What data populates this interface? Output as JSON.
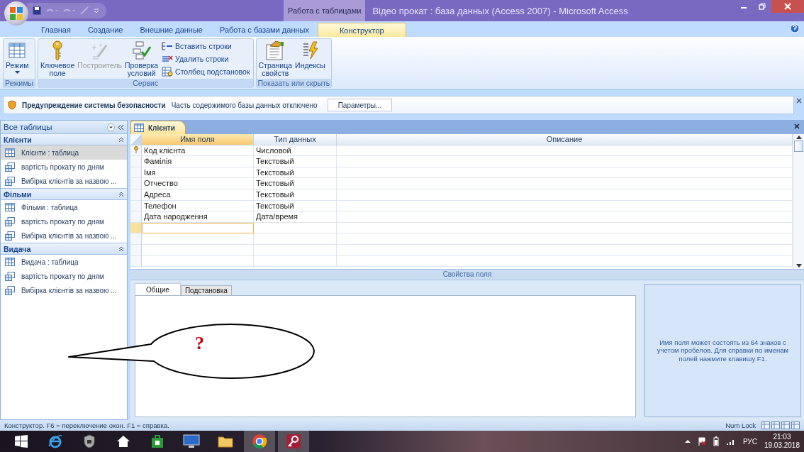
{
  "window": {
    "title": "Відео прокат : база данных (Access 2007) - Microsoft Access",
    "context_tab": "Работа с таблицами"
  },
  "ribbon": {
    "tabs": [
      {
        "label": "Главная",
        "selected": false
      },
      {
        "label": "Создание",
        "selected": false
      },
      {
        "label": "Внешние данные",
        "selected": false
      },
      {
        "label": "Работа с базами данных",
        "selected": false
      },
      {
        "label": "Конструктор",
        "selected": true
      }
    ],
    "groups": [
      {
        "label": "Режимы",
        "buttons": [
          {
            "label": "Режим",
            "kind": "view",
            "disabled": false
          }
        ]
      },
      {
        "label": "Сервис",
        "buttons": [
          {
            "label": "Ключевое поле",
            "kind": "key",
            "disabled": false
          },
          {
            "label": "Построитель",
            "kind": "builder",
            "disabled": true
          },
          {
            "label": "Проверка условий",
            "kind": "check",
            "disabled": false
          },
          {
            "label": "Вставить строки",
            "kind": "insert",
            "disabled": false
          },
          {
            "label": "Удалить строки",
            "kind": "delete",
            "disabled": false
          },
          {
            "label": "Столбец подстановок",
            "kind": "lookup",
            "disabled": false
          }
        ]
      },
      {
        "label": "Показать или скрыть",
        "buttons": [
          {
            "label": "Страница свойств",
            "kind": "sheet",
            "disabled": false
          },
          {
            "label": "Индексы",
            "kind": "indexes",
            "disabled": false
          }
        ]
      }
    ]
  },
  "security_bar": {
    "title": "Предупреждение системы безопасности",
    "message": "Часть содержимого базы данных отключено",
    "button": "Параметры..."
  },
  "nav_pane": {
    "title": "Все таблицы",
    "groups": [
      {
        "label": "Клієнти",
        "expanded": true,
        "items": [
          {
            "label": "Клієнти : таблица",
            "kind": "table",
            "selected": true
          },
          {
            "label": "вартість прокату по дням",
            "kind": "query",
            "selected": false
          },
          {
            "label": "Вибірка клієнтів за назвою ...",
            "kind": "query",
            "selected": false
          }
        ]
      },
      {
        "label": "Фільми",
        "expanded": true,
        "items": [
          {
            "label": "Фільми : таблица",
            "kind": "table",
            "selected": false
          },
          {
            "label": "вартість прокату по дням",
            "kind": "query",
            "selected": false
          },
          {
            "label": "Вибірка клієнтів за назвою ...",
            "kind": "query",
            "selected": false
          }
        ]
      },
      {
        "label": "Видача",
        "expanded": true,
        "items": [
          {
            "label": "Видача : таблица",
            "kind": "table",
            "selected": false
          },
          {
            "label": "вартість прокату по дням",
            "kind": "query",
            "selected": false
          },
          {
            "label": "Вибірка клієнтів за назвою ...",
            "kind": "query",
            "selected": false
          }
        ]
      }
    ]
  },
  "document_tab": "Клієнти",
  "grid": {
    "columns": [
      "Имя поля",
      "Тип данных",
      "Описание"
    ],
    "new_row_selected": true,
    "rows": [
      {
        "name": "Код клієнта",
        "type": "Числовой",
        "primary_key": true
      },
      {
        "name": "Фамілія",
        "type": "Текстовый",
        "primary_key": false
      },
      {
        "name": "Імя",
        "type": "Текстовый",
        "primary_key": false
      },
      {
        "name": "Отчество",
        "type": "Текстовый",
        "primary_key": false
      },
      {
        "name": "Адреса",
        "type": "Текстовый",
        "primary_key": false
      },
      {
        "name": "Телефон",
        "type": "Текстовый",
        "primary_key": false
      },
      {
        "name": "Дата народження",
        "type": "Дата/время",
        "primary_key": false
      }
    ]
  },
  "field_properties": {
    "title": "Свойства поля",
    "tabs": [
      {
        "label": "Общие",
        "selected": true
      },
      {
        "label": "Подстановка",
        "selected": false
      }
    ],
    "help": "Имя поля может состоять из 64 знаков с учетом пробелов.  Для справки по именам полей нажмите клавишу F1."
  },
  "callout": {
    "text": "?"
  },
  "status_bar": {
    "text": "Конструктор.  F6 = переключение окон.  F1 = справка.",
    "indicator": "Num Lock"
  },
  "taskbar": {
    "language": "РУС",
    "time": "21:03",
    "date": "19.03.2018"
  }
}
